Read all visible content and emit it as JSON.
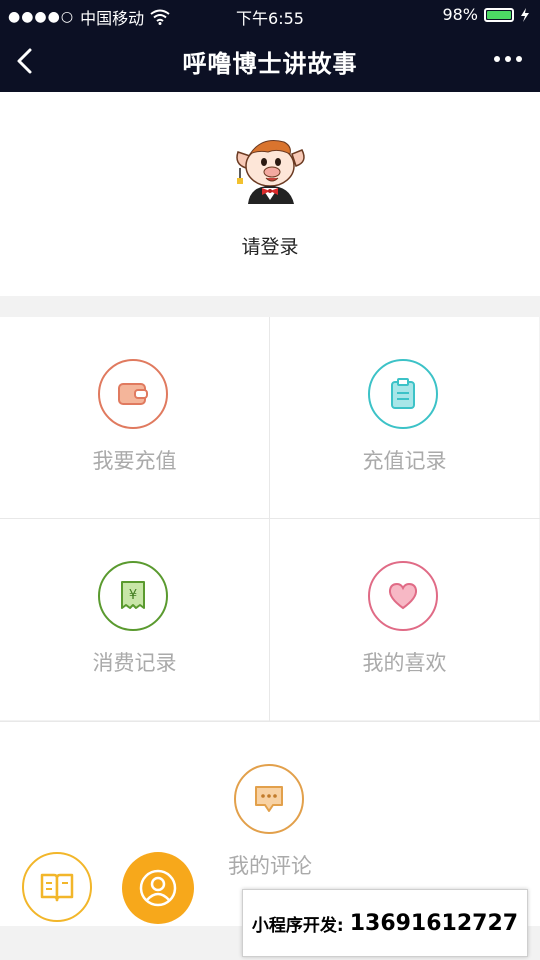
{
  "status_bar": {
    "signal_dots": "●●●●○",
    "carrier": "中国移动",
    "wifi_icon": "wifi-icon",
    "time": "下午6:55",
    "battery_percent": "98%",
    "battery_level": 0.98
  },
  "nav": {
    "title": "呼噜博士讲故事",
    "back_icon": "chevron-left-icon",
    "more_icon": "more-dots-icon"
  },
  "profile": {
    "login_label": "请登录"
  },
  "menu": {
    "recharge": "我要充值",
    "recharge_record": "充值记录",
    "consumption_record": "消费记录",
    "favorites": "我的喜欢",
    "comments": "我的评论"
  },
  "colors": {
    "nav_bg": "#0c1024",
    "recharge": "#e07a5f",
    "recharge_record": "#3cc2c7",
    "consumption_record": "#5a9a2f",
    "favorites": "#e06b86",
    "comments": "#e2a04b",
    "fab_accent": "#f7a81b"
  },
  "promo": {
    "label": "小程序开发:",
    "phone": "13691612727"
  }
}
